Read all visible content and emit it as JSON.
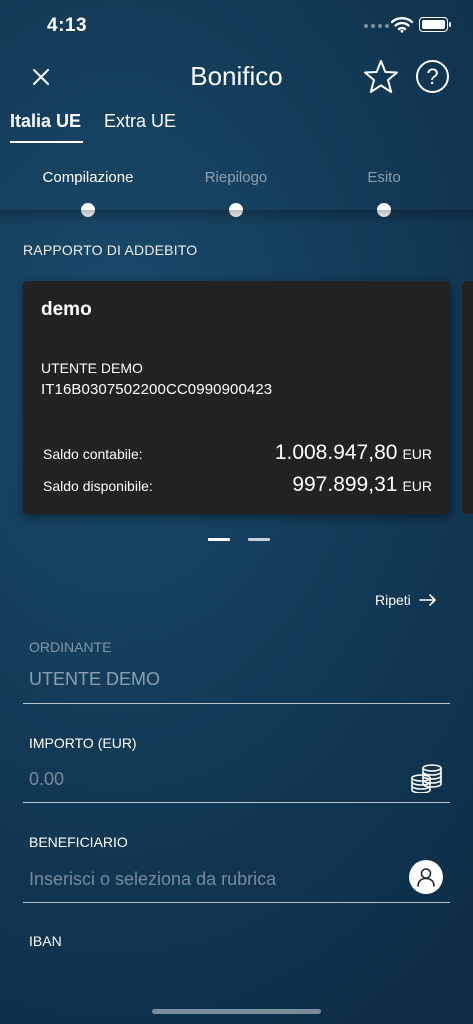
{
  "status_bar": {
    "time": "4:13"
  },
  "nav": {
    "title": "Bonifico",
    "help_glyph": "?"
  },
  "tabs": [
    {
      "label": "Italia UE",
      "active": true
    },
    {
      "label": "Extra UE",
      "active": false
    }
  ],
  "stepper": {
    "steps": [
      {
        "label": "Compilazione",
        "state": "current"
      },
      {
        "label": "Riepilogo",
        "state": "future"
      },
      {
        "label": "Esito",
        "state": "future"
      }
    ]
  },
  "account_section": {
    "label": "RAPPORTO DI ADDEBITO",
    "card": {
      "name": "demo",
      "holder": "UTENTE DEMO",
      "iban": "IT16B0307502200CC0990900423",
      "balances": [
        {
          "label": "Saldo contabile:",
          "amount": "1.008.947,80",
          "currency": "EUR"
        },
        {
          "label": "Saldo disponibile:",
          "amount": "997.899,31",
          "currency": "EUR"
        }
      ]
    },
    "pager": {
      "pages": 2,
      "current": 1
    }
  },
  "form": {
    "repeat_label": "Ripeti",
    "ordinante": {
      "label": "ORDINANTE",
      "value": "UTENTE DEMO"
    },
    "importo": {
      "label": "IMPORTO (EUR)",
      "placeholder": "0.00"
    },
    "beneficiario": {
      "label": "BENEFICIARIO",
      "placeholder": "Inserisci o seleziona da rubrica"
    },
    "iban": {
      "label": "IBAN"
    }
  },
  "icons": {
    "close": "close-icon",
    "favorite": "star-icon",
    "help": "help-icon",
    "repeat_arrow": "arrow-right-icon",
    "coins": "coins-icon",
    "contact": "contact-icon"
  },
  "colors": {
    "background": "#123a57",
    "card": "#222222",
    "text": "#ffffff"
  }
}
